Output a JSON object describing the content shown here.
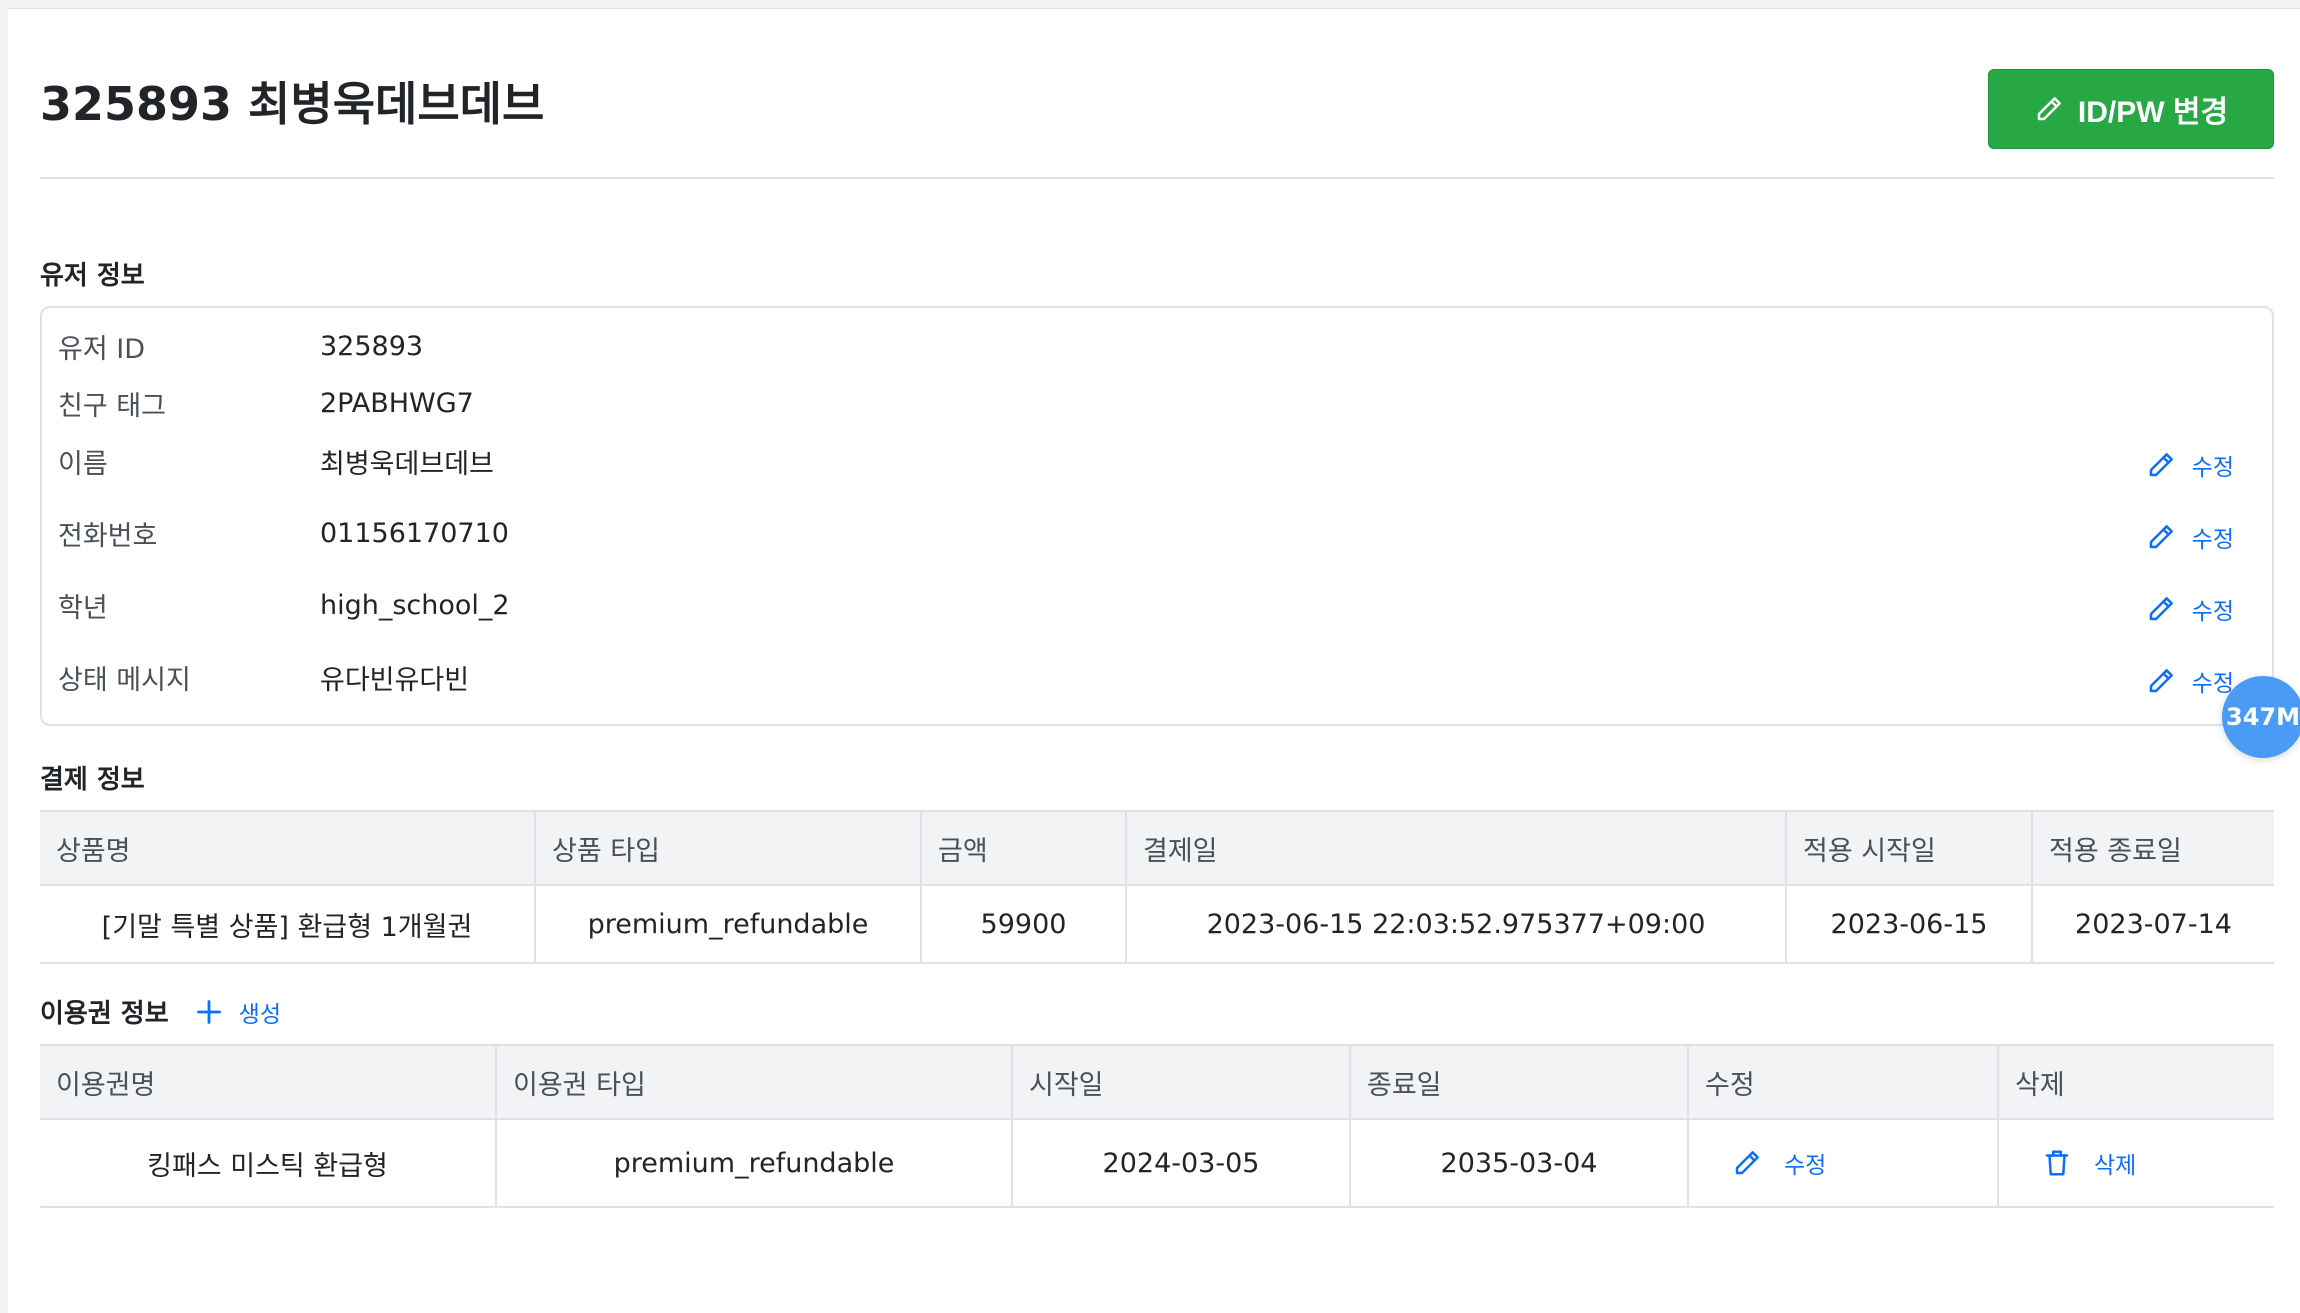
{
  "header": {
    "title": "325893 최병욱데브데브",
    "idpw_button_label": "ID/PW 변경",
    "idpw_icon": "pencil-icon"
  },
  "user_info": {
    "section_title": "유저 정보",
    "edit_label": "수정",
    "rows": [
      {
        "label": "유저 ID",
        "value": "325893"
      },
      {
        "label": "친구 태그",
        "value": "2PABHWG7"
      },
      {
        "label": "이름",
        "value": "최병욱데브데브"
      },
      {
        "label": "전화번호",
        "value": "01156170710"
      },
      {
        "label": "학년",
        "value": "high_school_2"
      },
      {
        "label": "상태 메시지",
        "value": "유다빈유다빈"
      }
    ]
  },
  "memory_badge": "347M",
  "payment": {
    "section_title": "결제 정보",
    "columns": [
      "상품명",
      "상품 타입",
      "금액",
      "결제일",
      "적용 시작일",
      "적용 종료일"
    ],
    "rows": [
      [
        "[기말 특별 상품] 환급형 1개월권",
        "premium_refundable",
        "59900",
        "2023-06-15 22:03:52.975377+09:00",
        "2023-06-15",
        "2023-07-14"
      ]
    ]
  },
  "tickets": {
    "section_title": "이용권 정보",
    "create_label": "생성",
    "columns": [
      "이용권명",
      "이용권 타입",
      "시작일",
      "종료일",
      "수정",
      "삭제"
    ],
    "rows": [
      {
        "name": "킹패스 미스틱 환급형",
        "type": "premium_refundable",
        "start": "2024-03-05",
        "end": "2035-03-04",
        "edit_label": "수정",
        "delete_label": "삭제"
      }
    ]
  },
  "colors": {
    "primary": "#0d6efd",
    "success": "#28a745",
    "badge": "#4a9bf5"
  }
}
